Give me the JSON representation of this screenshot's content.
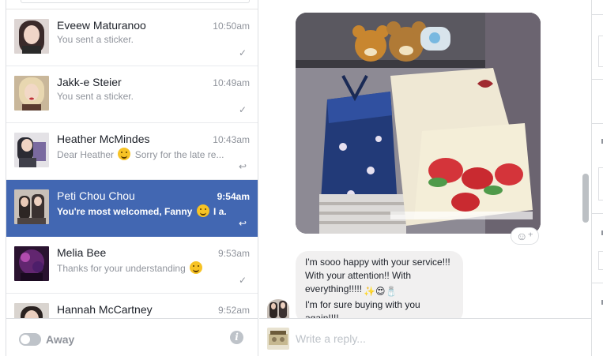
{
  "threads": [
    {
      "name": "Eveew Maturanoo",
      "time": "10:50am",
      "snippet": "You sent a sticker.",
      "status_icon": "check-icon",
      "status_glyph": "✓",
      "active": false,
      "has_emoji": false,
      "snippet_after": ""
    },
    {
      "name": "Jakk-e Steier",
      "time": "10:49am",
      "snippet": "You sent a sticker.",
      "status_icon": "check-icon",
      "status_glyph": "✓",
      "active": false,
      "has_emoji": false,
      "snippet_after": ""
    },
    {
      "name": "Heather McMindes",
      "time": "10:43am",
      "snippet": "Dear Heather",
      "snippet_after": "Sorry for the late re...",
      "status_icon": "reply-icon",
      "status_glyph": "↩",
      "active": false,
      "has_emoji": true
    },
    {
      "name": "Peti Chou Chou",
      "time": "9:54am",
      "snippet": "You're most welcomed, Fanny",
      "snippet_after": "I a...",
      "status_icon": "reply-icon",
      "status_glyph": "↩",
      "active": true,
      "has_emoji": true
    },
    {
      "name": "Melia Bee",
      "time": "9:53am",
      "snippet": "Thanks for your understanding",
      "snippet_after": "",
      "status_icon": "check-icon",
      "status_glyph": "✓",
      "active": false,
      "has_emoji": true
    },
    {
      "name": "Hannah McCartney",
      "time": "9:52am",
      "snippet": "",
      "snippet_after": "",
      "status_icon": "",
      "status_glyph": "",
      "active": false,
      "has_emoji": false
    }
  ],
  "status_bar": {
    "away_label": "Away",
    "info_glyph": "i"
  },
  "conversation": {
    "reaction_glyph": "☺⁺",
    "message_lines": [
      "I'm sooo happy with your service!!!",
      "With your attention!! With",
      "everything!!!!!",
      "I'm for sure buying with you",
      "again!!!!"
    ],
    "message_emojis": "✨😍🧂"
  },
  "reply": {
    "placeholder": "Write a reply..."
  },
  "colors": {
    "active_thread": "#4267b2",
    "bubble_bg": "#f1f0f0",
    "muted_text": "#90949c"
  }
}
